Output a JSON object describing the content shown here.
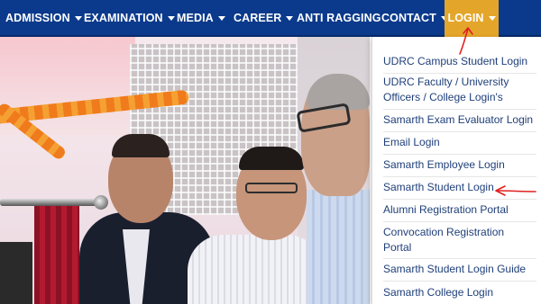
{
  "nav": {
    "items": [
      {
        "label": "ADMISSION",
        "has_caret": true
      },
      {
        "label": "EXAMINATION",
        "has_caret": true
      },
      {
        "label": "MEDIA",
        "has_caret": true
      },
      {
        "label": "CAREER",
        "has_caret": true
      },
      {
        "label": "ANTI RAGGING",
        "has_caret": false
      },
      {
        "label": "CONTACT",
        "has_caret": true
      },
      {
        "label": "LOGIN",
        "has_caret": true,
        "active": true
      }
    ],
    "colors": {
      "bar": "#0b3a8c",
      "active": "#e4a62a",
      "text": "#ffffff"
    }
  },
  "login_menu": {
    "items": [
      {
        "label": "UDRC Campus Student Login"
      },
      {
        "label": "UDRC Faculty / University Officers / College Login's"
      },
      {
        "label": "Samarth Exam Evaluator Login"
      },
      {
        "label": "Email Login"
      },
      {
        "label": "Samarth Employee Login"
      },
      {
        "label": "Samarth Student Login",
        "annotated": true
      },
      {
        "label": "Alumni Registration Portal"
      },
      {
        "label": "Convocation Registration Portal"
      },
      {
        "label": "Samarth Student Login Guide"
      },
      {
        "label": "Samarth College Login"
      }
    ],
    "link_color": "#1f3f7a"
  },
  "hero": {
    "description_icon": "event-photo"
  },
  "annotations": {
    "color": "#e02020",
    "arrows": [
      "arrow-to-login-tab",
      "arrow-to-samarth-student-login"
    ]
  }
}
